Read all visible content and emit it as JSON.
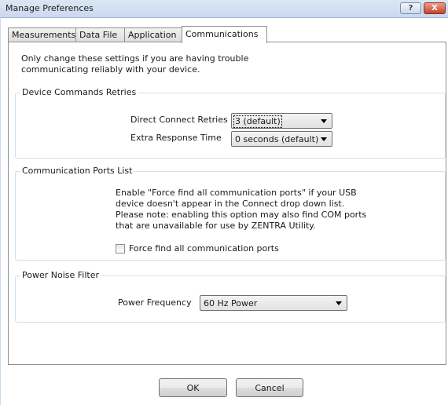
{
  "window": {
    "title": "Manage Preferences",
    "help_symbol": "?",
    "close_symbol": "X"
  },
  "tabs": [
    {
      "label": "Measurements",
      "active": false
    },
    {
      "label": "Data File",
      "active": false
    },
    {
      "label": "Application",
      "active": false
    },
    {
      "label": "Communications",
      "active": true
    }
  ],
  "intro_text": "Only change these settings if you are having trouble communicating reliably with your device.",
  "device_commands": {
    "title": "Device Commands Retries",
    "direct_connect_label": "Direct Connect Retries",
    "direct_connect_value": "3 (default)",
    "extra_response_label": "Extra Response Time",
    "extra_response_value": "0 seconds (default)"
  },
  "ports": {
    "title": "Communication Ports List",
    "description": "Enable \"Force find all communication ports\" if your USB device doesn't appear in the Connect drop down list. Please note: enabling this option may also find COM ports that are unavailable for use by ZENTRA Utility.",
    "checkbox_label": "Force find all communication ports",
    "checkbox_checked": false
  },
  "power": {
    "title": "Power Noise Filter",
    "frequency_label": "Power Frequency",
    "frequency_value": "60 Hz Power"
  },
  "buttons": {
    "ok": "OK",
    "cancel": "Cancel"
  },
  "colors": {
    "titlebar": "#c9d9ee",
    "close_button": "#c7412a",
    "group_border": "#d5dfe5"
  }
}
